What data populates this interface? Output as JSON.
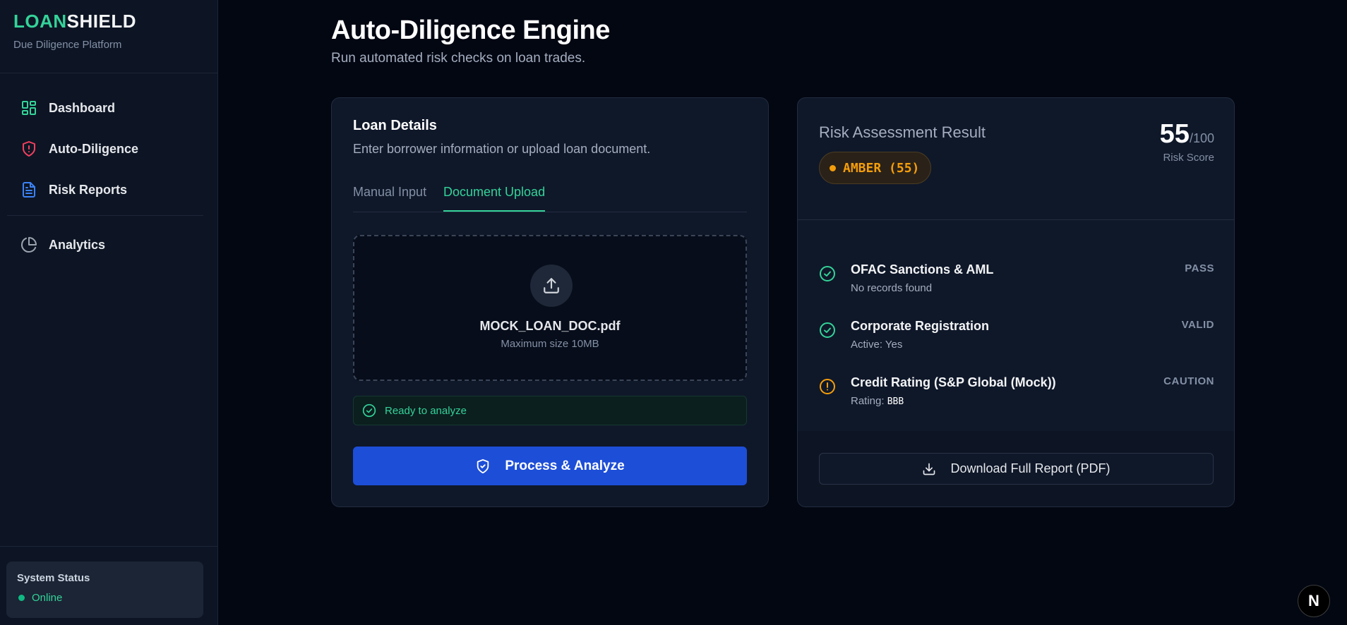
{
  "sidebar": {
    "brand_part1": "LOAN",
    "brand_part2": "SHIELD",
    "brand_sub": "Due Diligence Platform",
    "items": [
      {
        "label": "Dashboard",
        "icon": "dashboard-icon"
      },
      {
        "label": "Auto-Diligence",
        "icon": "shield-alert-icon"
      },
      {
        "label": "Risk Reports",
        "icon": "file-text-icon"
      },
      {
        "label": "Analytics",
        "icon": "pie-chart-icon"
      }
    ],
    "status": {
      "title": "System Status",
      "value": "Online"
    }
  },
  "header": {
    "title": "Auto-Diligence Engine",
    "subtitle": "Run automated risk checks on loan trades."
  },
  "loan_details": {
    "title": "Loan Details",
    "subtitle": "Enter borrower information or upload loan document.",
    "tabs": [
      {
        "label": "Manual Input",
        "active": false
      },
      {
        "label": "Document Upload",
        "active": true
      }
    ],
    "upload": {
      "file_name": "MOCK_LOAN_DOC.pdf",
      "hint": "Maximum size 10MB"
    },
    "ready_text": "Ready to analyze",
    "process_button": "Process & Analyze"
  },
  "result": {
    "title": "Risk Assessment Result",
    "badge": "AMBER (55)",
    "score": "55",
    "score_max": "/100",
    "score_label": "Risk Score",
    "checks": [
      {
        "title": "OFAC Sanctions & AML",
        "detail_prefix": "No records found",
        "detail_value": "",
        "status": "PASS",
        "state": "ok"
      },
      {
        "title": "Corporate Registration",
        "detail_prefix": "Active: Yes",
        "detail_value": "",
        "status": "VALID",
        "state": "ok"
      },
      {
        "title": "Credit Rating (S&P Global (Mock))",
        "detail_prefix": "Rating: ",
        "detail_value": "BBB",
        "status": "CAUTION",
        "state": "warn"
      }
    ],
    "download_button": "Download Full Report (PDF)"
  },
  "floating_badge": "N",
  "colors": {
    "accent_green": "#34d399",
    "primary_blue": "#1d4ed8",
    "amber": "#f59e0b",
    "background": "#030712"
  }
}
